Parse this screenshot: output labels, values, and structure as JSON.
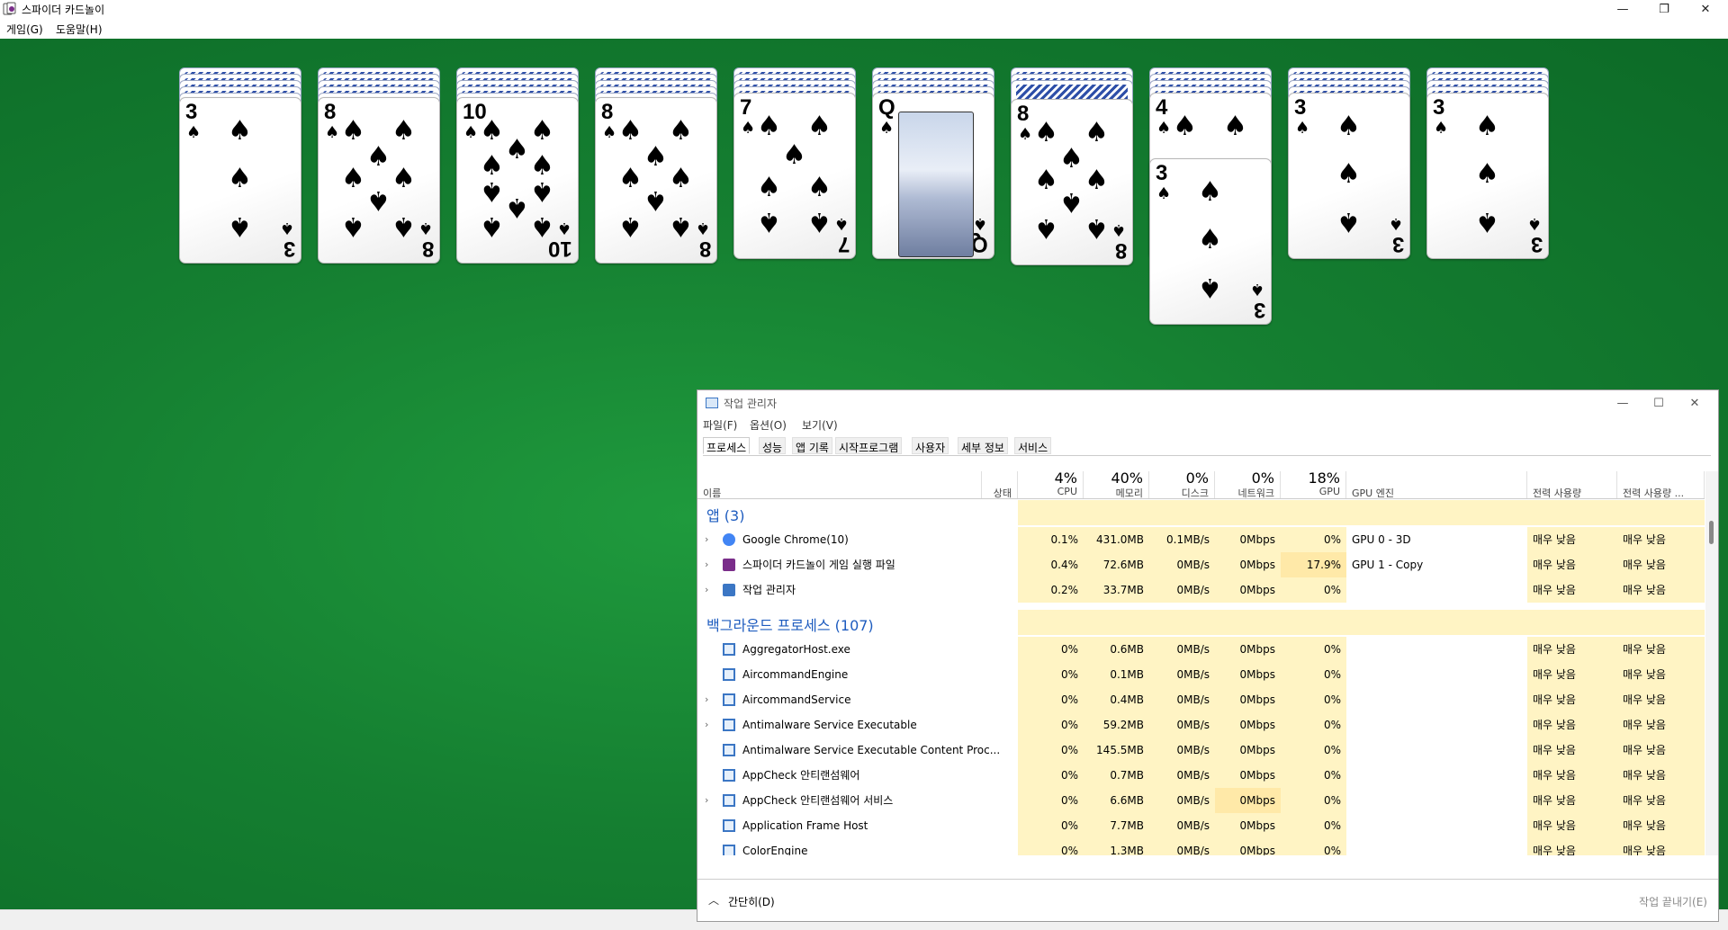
{
  "solitaire": {
    "title": "스파이더 카드놀이",
    "menu": [
      "게임(G)",
      "도움말(H)"
    ]
  },
  "columns": [
    {
      "backs": 5,
      "top": {
        "rank": "3",
        "suit": "♠"
      }
    },
    {
      "backs": 5,
      "top": {
        "rank": "8",
        "suit": "♠"
      }
    },
    {
      "backs": 5,
      "top": {
        "rank": "10",
        "suit": "♠"
      }
    },
    {
      "backs": 5,
      "top": {
        "rank": "8",
        "suit": "♠"
      }
    },
    {
      "backs": 4,
      "top": {
        "rank": "7",
        "suit": "♠"
      }
    },
    {
      "backs": 4,
      "top": {
        "rank": "Q",
        "suit": "♠"
      }
    },
    {
      "backs": 3,
      "top": {
        "rank": "8",
        "suit": "♠"
      }
    },
    {
      "backs": 4,
      "top": {
        "rank": "4",
        "suit": "♠"
      },
      "second": {
        "rank": "3",
        "suit": "♠"
      }
    },
    {
      "backs": 4,
      "top": {
        "rank": "3",
        "suit": "♠"
      }
    },
    {
      "backs": 4,
      "top": {
        "rank": "3",
        "suit": "♠"
      }
    }
  ],
  "taskmanager": {
    "title": "작업 관리자",
    "menu": [
      "파일(F)",
      "옵션(O)",
      "보기(V)"
    ],
    "tabs": [
      "프로세스",
      "성능",
      "앱 기록",
      "시작프로그램",
      "사용자",
      "세부 정보",
      "서비스"
    ],
    "headers": {
      "name": "이름",
      "status": "상태",
      "cpu_pct": "4%",
      "cpu": "CPU",
      "mem_pct": "40%",
      "mem": "메모리",
      "disk_pct": "0%",
      "disk": "디스크",
      "net_pct": "0%",
      "net": "네트워크",
      "gpu_pct": "18%",
      "gpu": "GPU",
      "gpu_engine": "GPU 엔진",
      "power": "전력 사용량",
      "power_trend": "전력 사용량 ..."
    },
    "groups": {
      "apps": "앱 (3)",
      "background": "백그라운드 프로세스 (107)"
    },
    "apps": [
      {
        "name": "Google Chrome(10)",
        "cpu": "0.1%",
        "mem": "431.0MB",
        "disk": "0.1MB/s",
        "net": "0Mbps",
        "gpu": "0%",
        "engine": "GPU 0 - 3D",
        "power": "매우 낮음",
        "trend": "매우 낮음"
      },
      {
        "name": "스파이더 카드놀이 게임 실행 파일",
        "cpu": "0.4%",
        "mem": "72.6MB",
        "disk": "0MB/s",
        "net": "0Mbps",
        "gpu": "17.9%",
        "engine": "GPU 1 - Copy",
        "power": "매우 낮음",
        "trend": "매우 낮음"
      },
      {
        "name": "작업 관리자",
        "cpu": "0.2%",
        "mem": "33.7MB",
        "disk": "0MB/s",
        "net": "0Mbps",
        "gpu": "0%",
        "engine": "",
        "power": "매우 낮음",
        "trend": "매우 낮음"
      }
    ],
    "background": [
      {
        "name": "AggregatorHost.exe",
        "cpu": "0%",
        "mem": "0.6MB",
        "disk": "0MB/s",
        "net": "0Mbps",
        "gpu": "0%",
        "power": "매우 낮음",
        "trend": "매우 낮음"
      },
      {
        "name": "AircommandEngine",
        "cpu": "0%",
        "mem": "0.1MB",
        "disk": "0MB/s",
        "net": "0Mbps",
        "gpu": "0%",
        "power": "매우 낮음",
        "trend": "매우 낮음"
      },
      {
        "name": "AircommandService",
        "cpu": "0%",
        "mem": "0.4MB",
        "disk": "0MB/s",
        "net": "0Mbps",
        "gpu": "0%",
        "power": "매우 낮음",
        "trend": "매우 낮음"
      },
      {
        "name": "Antimalware Service Executable",
        "cpu": "0%",
        "mem": "59.2MB",
        "disk": "0MB/s",
        "net": "0Mbps",
        "gpu": "0%",
        "power": "매우 낮음",
        "trend": "매우 낮음"
      },
      {
        "name": "Antimalware Service Executable Content Proc...",
        "cpu": "0%",
        "mem": "145.5MB",
        "disk": "0MB/s",
        "net": "0Mbps",
        "gpu": "0%",
        "power": "매우 낮음",
        "trend": "매우 낮음"
      },
      {
        "name": "AppCheck 안티랜섬웨어",
        "cpu": "0%",
        "mem": "0.7MB",
        "disk": "0MB/s",
        "net": "0Mbps",
        "gpu": "0%",
        "power": "매우 낮음",
        "trend": "매우 낮음"
      },
      {
        "name": "AppCheck 안티랜섬웨어 서비스",
        "cpu": "0%",
        "mem": "6.6MB",
        "disk": "0MB/s",
        "net": "0Mbps",
        "gpu": "0%",
        "power": "매우 낮음",
        "trend": "매우 낮음"
      },
      {
        "name": "Application Frame Host",
        "cpu": "0%",
        "mem": "7.7MB",
        "disk": "0MB/s",
        "net": "0Mbps",
        "gpu": "0%",
        "power": "매우 낮음",
        "trend": "매우 낮음"
      },
      {
        "name": "ColorEngine",
        "cpu": "0%",
        "mem": "1.3MB",
        "disk": "0MB/s",
        "net": "0Mbps",
        "gpu": "0%",
        "power": "매우 낮음",
        "trend": "매우 낮음"
      }
    ],
    "footer": {
      "less": "간단히(D)",
      "end_task": "작업 끝내기(E)"
    }
  }
}
